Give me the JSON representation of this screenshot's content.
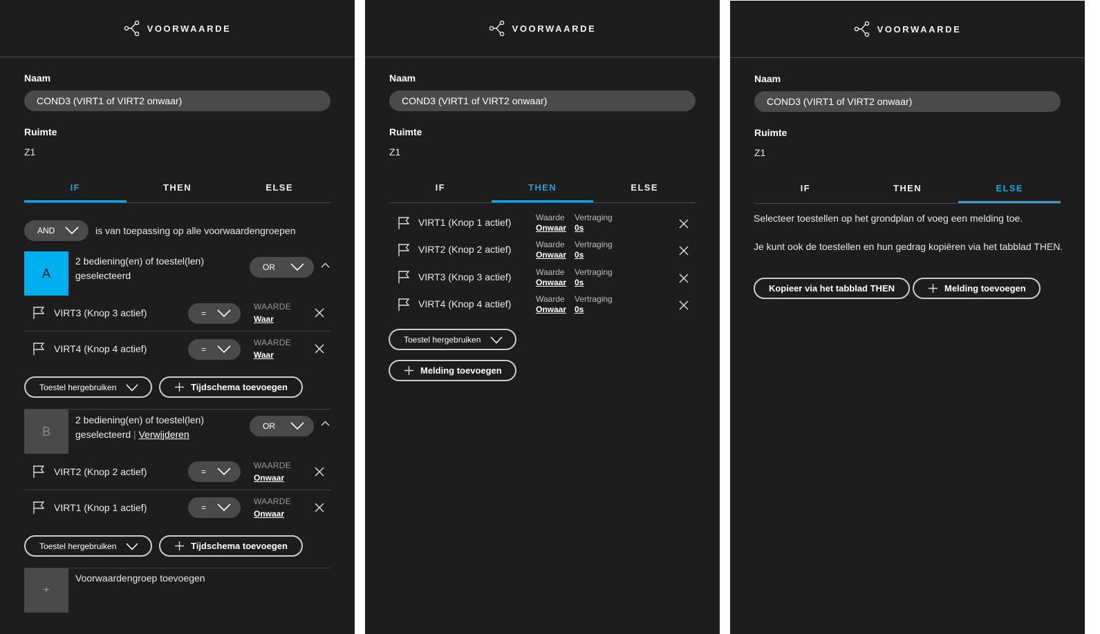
{
  "panels": [
    {
      "header": "VOORWAARDE",
      "name_label": "Naam",
      "name_value": "COND3 (VIRT1 of VIRT2 onwaar)",
      "room_label": "Ruimte",
      "room_value": "Z1",
      "tabs": [
        "IF",
        "THEN",
        "ELSE"
      ],
      "active_tab": "IF"
    },
    {
      "header": "VOORWAARDE",
      "name_label": "Naam",
      "name_value": "COND3 (VIRT1 of VIRT2 onwaar)",
      "room_label": "Ruimte",
      "room_value": "Z1",
      "tabs": [
        "IF",
        "THEN",
        "ELSE"
      ],
      "active_tab": "THEN"
    },
    {
      "header": "VOORWAARDE",
      "name_label": "Naam",
      "name_value": "COND3 (VIRT1 of VIRT2 onwaar)",
      "room_label": "Ruimte",
      "room_value": "Z1",
      "tabs": [
        "IF",
        "THEN",
        "ELSE"
      ],
      "active_tab": "ELSE"
    }
  ],
  "if_view": {
    "operator": "AND",
    "operator_desc": "is van toepassing op alle voorwaardengroepen",
    "groups": [
      {
        "letter": "A",
        "text1": "2 bediening(en) of toestel(len)",
        "text2": "geselecteerd",
        "remove_link": "",
        "operator": "OR",
        "rows": [
          {
            "device": "VIRT3 (Knop 3 actief)",
            "comparator": "=",
            "value_caption": "WAARDE",
            "value": "Waar"
          },
          {
            "device": "VIRT4 (Knop 4 actief)",
            "comparator": "=",
            "value_caption": "WAARDE",
            "value": "Waar"
          }
        ],
        "reuse_label": "Toestel hergebruiken",
        "schedule_label": "Tijdschema toevoegen"
      },
      {
        "letter": "B",
        "text1": "2 bediening(en) of toestel(len)",
        "text2": "geselecteerd",
        "separator": "|",
        "remove_link": "Verwijderen",
        "operator": "OR",
        "rows": [
          {
            "device": "VIRT2 (Knop 2 actief)",
            "comparator": "=",
            "value_caption": "WAARDE",
            "value": "Onwaar"
          },
          {
            "device": "VIRT1 (Knop 1 actief)",
            "comparator": "=",
            "value_caption": "WAARDE",
            "value": "Onwaar"
          }
        ],
        "reuse_label": "Toestel hergebruiken",
        "schedule_label": "Tijdschema toevoegen"
      }
    ],
    "add_group_label": "Voorwaardengroep toevoegen",
    "add_group_symbol": "+"
  },
  "then_view": {
    "rows": [
      {
        "device": "VIRT1 (Knop 1 actief)",
        "waarde_caption": "Waarde",
        "waarde": "Onwaar",
        "delay_caption": "Vertraging",
        "delay": "0s"
      },
      {
        "device": "VIRT2 (Knop 2 actief)",
        "waarde_caption": "Waarde",
        "waarde": "Onwaar",
        "delay_caption": "Vertraging",
        "delay": "0s"
      },
      {
        "device": "VIRT3 (Knop 3 actief)",
        "waarde_caption": "Waarde",
        "waarde": "Onwaar",
        "delay_caption": "Vertraging",
        "delay": "0s"
      },
      {
        "device": "VIRT4 (Knop 4 actief)",
        "waarde_caption": "Waarde",
        "waarde": "Onwaar",
        "delay_caption": "Vertraging",
        "delay": "0s"
      }
    ],
    "reuse_label": "Toestel hergebruiken",
    "add_notification_label": "Melding toevoegen"
  },
  "else_view": {
    "line1": "Selecteer toestellen op het grondplan of voeg een melding toe.",
    "line2": "Je kunt ook de toestellen en hun gedrag kopiëren via het tabblad THEN.",
    "copy_label": "Kopieer via het tabblad THEN",
    "add_notification_label": "Melding toevoegen"
  },
  "colors": {
    "accent": "#1aa6e0",
    "panel_bg": "#1d1d1d",
    "input_bg": "#4a4a4a",
    "group_a": "#00aeef",
    "group_b": "#4a4a4a"
  }
}
